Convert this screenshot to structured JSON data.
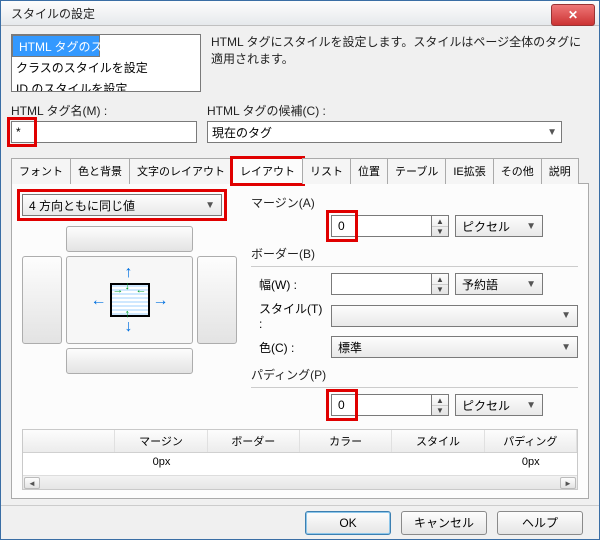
{
  "title": "スタイルの設定",
  "list": {
    "items": [
      "HTML タグのスタイルを設定",
      "クラスのスタイルを設定",
      "ID のスタイルを設定"
    ]
  },
  "description": "HTML タグにスタイルを設定します。スタイルはページ全体のタグに適用されます。",
  "tagname_label": "HTML タグ名(M) :",
  "tagname_value": "*",
  "candidates_label": "HTML タグの候補(C) :",
  "candidates_value": "現在のタグ",
  "tabs": [
    "フォント",
    "色と背景",
    "文字のレイアウト",
    "レイアウト",
    "リスト",
    "位置",
    "テーブル",
    "IE拡張",
    "その他",
    "説明"
  ],
  "active_tab": "レイアウト",
  "direction_select": "4 方向ともに同じ値",
  "margin": {
    "label": "マージン(A)",
    "value": "0",
    "unit": "ピクセル"
  },
  "border": {
    "label": "ボーダー(B)",
    "width_label": "幅(W) :",
    "width_value": "",
    "width_unit": "予約語",
    "style_label": "スタイル(T) :",
    "style_value": "",
    "color_label": "色(C) :",
    "color_value": "標準"
  },
  "padding": {
    "label": "パディング(P)",
    "value": "0",
    "unit": "ピクセル"
  },
  "table": {
    "headers": [
      "",
      "マージン",
      "ボーダー",
      "カラー",
      "スタイル",
      "パディング"
    ],
    "row": [
      "",
      "0px",
      "",
      "",
      "",
      "0px"
    ]
  },
  "buttons": {
    "ok": "OK",
    "cancel": "キャンセル",
    "help": "ヘルプ"
  }
}
